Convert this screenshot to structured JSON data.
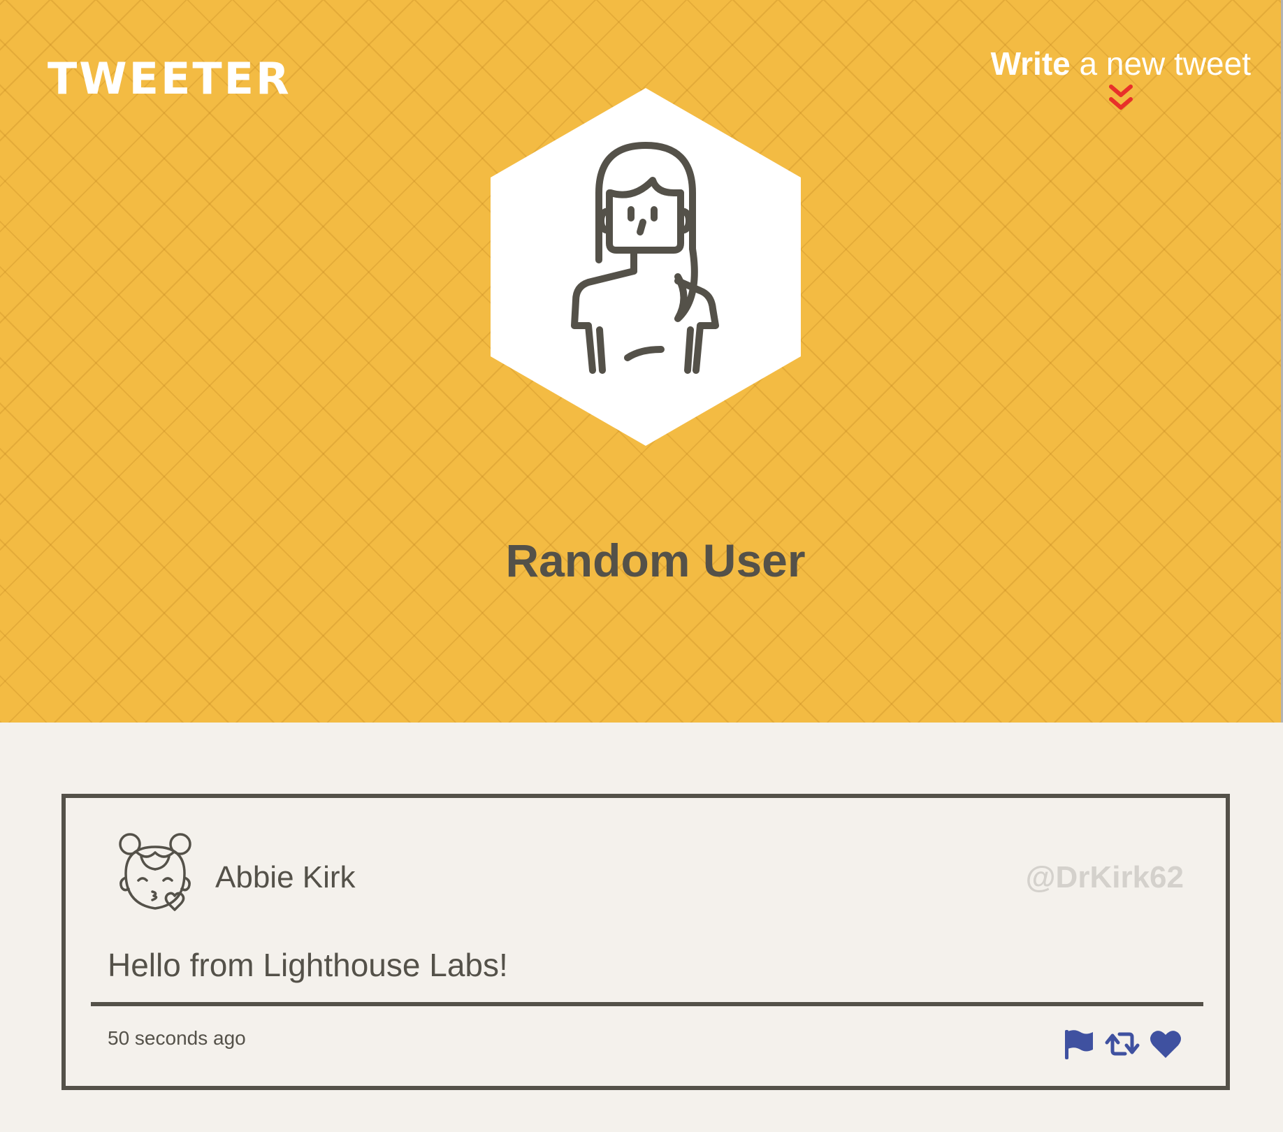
{
  "header": {
    "logo": "TWEETER",
    "compose_bold": "Write",
    "compose_rest": " a new tweet",
    "accent_color": "#f3bb43",
    "chevron_color": "#e8302a"
  },
  "profile": {
    "name": "Random User"
  },
  "tweet": {
    "author": "Abbie Kirk",
    "handle": "@DrKirk62",
    "content": "Hello from Lighthouse Labs!",
    "time_ago": "50 seconds ago",
    "actions": [
      "flag-icon",
      "retweet-icon",
      "heart-icon"
    ],
    "action_color": "#3f51a0"
  }
}
